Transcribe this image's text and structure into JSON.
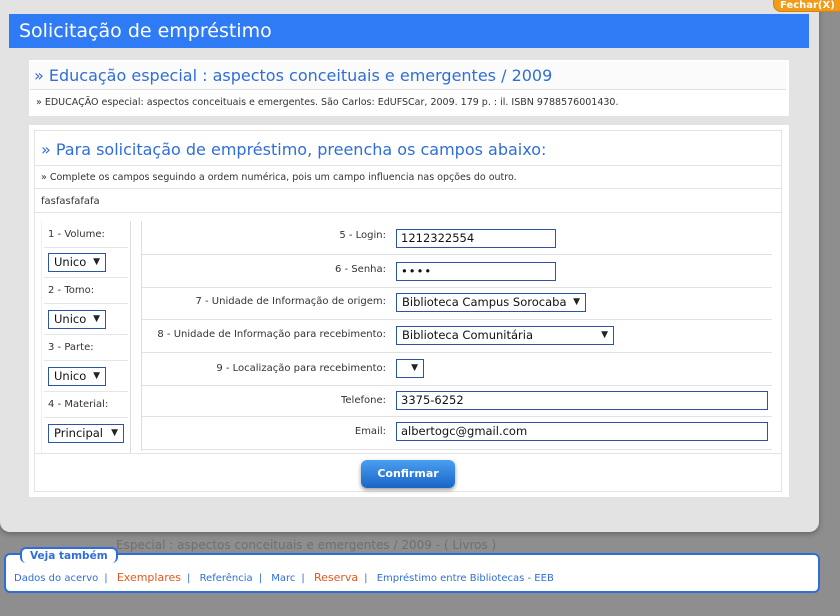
{
  "dialog": {
    "title": "Solicitação de empréstimo",
    "close_label": "Fechar(X)"
  },
  "book": {
    "title": "» Educação especial : aspectos conceituais e emergentes / 2009",
    "reference": "» EDUCAÇÃO especial: aspectos conceituais e emergentes. São Carlos: EdUFSCar, 2009. 179 p. : il. ISBN 9788576001430."
  },
  "form": {
    "title": "» Para solicitação de empréstimo, preencha os campos abaixo:",
    "hint": "» Complete os campos seguindo a ordem numérica, pois um campo influencia nas opções do outro.",
    "note": "fasfasfafafa",
    "left_fields": [
      {
        "label": "1 - Volume:",
        "value": "Unico"
      },
      {
        "label": "2 - Tomo:",
        "value": "Unico"
      },
      {
        "label": "3 - Parte:",
        "value": "Unico"
      },
      {
        "label": "4 - Material:",
        "value": "Principal"
      }
    ],
    "login": {
      "label": "5 - Login:",
      "value": "1212322554"
    },
    "senha": {
      "label": "6 - Senha:",
      "value": "••••"
    },
    "unidade_origem": {
      "label": "7 - Unidade de Informação de origem:",
      "value": "Biblioteca Campus Sorocaba"
    },
    "unidade_recebimento": {
      "label": "8 - Unidade de Informação para recebimento:",
      "value": "Biblioteca Comunitária"
    },
    "localizacao": {
      "label": "9 - Localização para recebimento:",
      "value": ""
    },
    "telefone": {
      "label": "Telefone:",
      "value": "3375-6252"
    },
    "email": {
      "label": "Email:",
      "value": "albertogc@gmail.com"
    },
    "confirm_label": "Confirmar"
  },
  "see_also": {
    "title": "Veja também",
    "links": [
      "Dados do acervo",
      "Exemplares",
      "Referência",
      "Marc",
      "Reserva",
      "Empréstimo entre Bibliotecas - EEB"
    ]
  },
  "background": {
    "line1": "Especial : aspectos conceituais e emergentes / 2009 - ( Livros )"
  },
  "colors": {
    "header": "#2f7bf5",
    "accent": "#2f6ed9",
    "orange": "#e05a1c",
    "close": "#f29b1a"
  }
}
